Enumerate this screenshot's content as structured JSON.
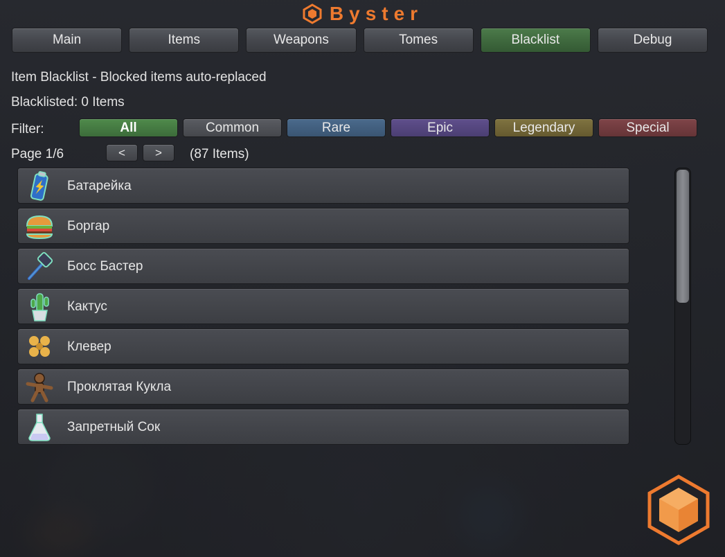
{
  "app": {
    "title": "Byster"
  },
  "tabs": [
    {
      "label": "Main",
      "active": false
    },
    {
      "label": "Items",
      "active": false
    },
    {
      "label": "Weapons",
      "active": false
    },
    {
      "label": "Tomes",
      "active": false
    },
    {
      "label": "Blacklist",
      "active": true
    },
    {
      "label": "Debug",
      "active": false
    }
  ],
  "blacklist": {
    "heading": "Item Blacklist - Blocked items auto-replaced",
    "count_text": "Blacklisted: 0 Items",
    "filter_label": "Filter:",
    "filters": [
      "All",
      "Common",
      "Rare",
      "Epic",
      "Legendary",
      "Special"
    ],
    "selected_filter": "All",
    "page_label": "Page 1/6",
    "prev_label": "<",
    "next_label": ">",
    "total_text": "(87 Items)"
  },
  "items": [
    {
      "name": "Батарейка",
      "icon": "battery-icon"
    },
    {
      "name": "Боргар",
      "icon": "burger-icon"
    },
    {
      "name": "Босс Бастер",
      "icon": "hammer-icon"
    },
    {
      "name": "Кактус",
      "icon": "cactus-icon"
    },
    {
      "name": "Клевер",
      "icon": "clover-icon"
    },
    {
      "name": "Проклятая Кукла",
      "icon": "voodoo-doll-icon"
    },
    {
      "name": "Запретный Сок",
      "icon": "potion-flask-icon"
    }
  ],
  "scroll": {
    "position_fraction": 0.0,
    "visible_fraction": 0.48
  },
  "colors": {
    "brand": "#ee7a2f",
    "active_tab": "#3e683d",
    "filter_all": "#4f8a4b",
    "filter_common": "#4f5156",
    "filter_rare": "#425f80",
    "filter_epic": "#554680",
    "filter_legendary": "#726738",
    "filter_special": "#723c40"
  }
}
